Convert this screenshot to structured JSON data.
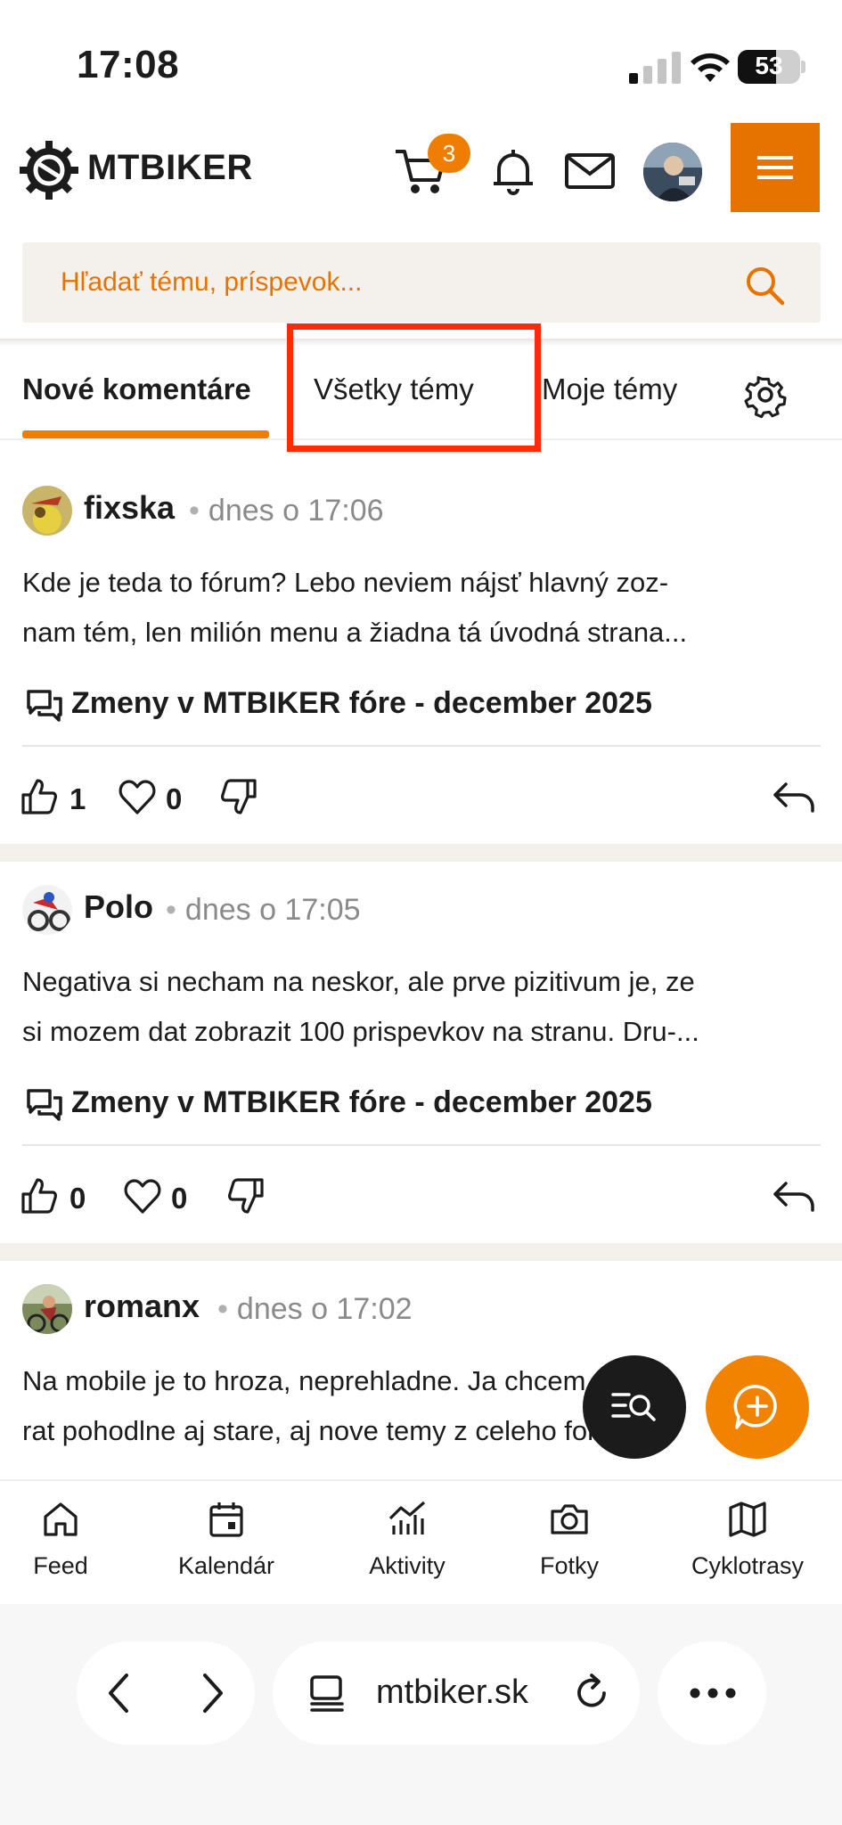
{
  "status": {
    "time": "17:08",
    "battery": "53"
  },
  "header": {
    "logo_text": "MTBIKER",
    "cart_count": "3",
    "icons": [
      "cart-icon",
      "bell-icon",
      "mail-icon",
      "avatar",
      "menu-icon"
    ]
  },
  "search": {
    "placeholder": "Hľadať tému, príspevok..."
  },
  "tabs": [
    {
      "label": "Nové komentáre",
      "active": true
    },
    {
      "label": "Všetky témy",
      "active": false,
      "highlighted": true
    },
    {
      "label": "Moje témy",
      "active": false
    }
  ],
  "posts": [
    {
      "author": "fixska",
      "time": "dnes o 17:06",
      "text_line1": "Kde je teda to fórum? Lebo neviem nájsť hlavný zoz-",
      "text_line2": "nam tém, len milión menu a žiadna tá úvodná strana...",
      "topic": "Zmeny v MTBIKER fóre - december 2025",
      "likes": "1",
      "hearts": "0"
    },
    {
      "author": "Polo",
      "time": "dnes o 17:05",
      "text_line1": "Negativa si necham na neskor, ale prve pizitivum je, ze",
      "text_line2": "si mozem dat zobrazit 100 prispevkov na stranu. Dru-...",
      "topic": "Zmeny v MTBIKER fóre - december 2025",
      "likes": "0",
      "hearts": "0"
    },
    {
      "author": "romanx",
      "time": "dnes o 17:02",
      "text_line1": "Na mobile je to hroza, neprehladne. Ja chcem vyber-",
      "text_line2": "rat pohodlne aj stare, aj nove temy z celeho fora...",
      "topic": "",
      "likes": "",
      "hearts": ""
    }
  ],
  "bottom_nav": [
    {
      "label": "Feed",
      "icon": "home-icon"
    },
    {
      "label": "Kalendár",
      "icon": "calendar-icon"
    },
    {
      "label": "Aktivity",
      "icon": "activity-chart-icon"
    },
    {
      "label": "Fotky",
      "icon": "camera-icon"
    },
    {
      "label": "Cyklotrasy",
      "icon": "map-icon"
    }
  ],
  "browser": {
    "url": "mtbiker.sk"
  },
  "colors": {
    "accent": "#ef7d00",
    "highlight": "#ff2a0a",
    "band": "#f4f1ec"
  }
}
